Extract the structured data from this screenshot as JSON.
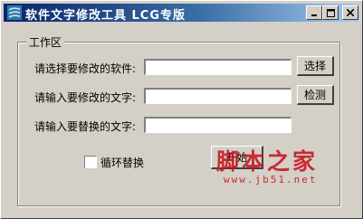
{
  "window": {
    "title": "软件文字修改工具 LCG专版",
    "icons": {
      "app": "app-icon",
      "minimize": "minimize-icon",
      "maximize": "maximize-icon",
      "close": "close-icon"
    }
  },
  "group": {
    "title": "工作区"
  },
  "form": {
    "software_label": "请选择要修改的软件:",
    "software_value": "",
    "search_label": "请输入要修改的文字:",
    "search_value": "",
    "replace_label": "请输入要替换的文字:",
    "replace_value": "",
    "select_button": "选择",
    "detect_button": "检测",
    "loop_label": "循环替换",
    "loop_checked": false,
    "start_button": "开始"
  },
  "watermark": {
    "text": "脚本之家",
    "url": "www.jb51.net",
    "color": "#c8141e"
  }
}
